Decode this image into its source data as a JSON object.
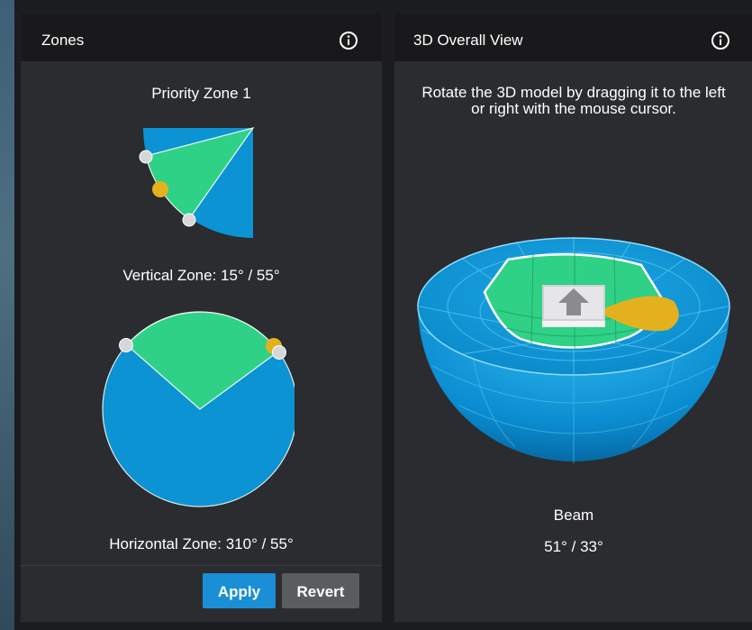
{
  "zones_panel": {
    "title": "Zones",
    "zone_name": "Priority Zone 1",
    "vertical_zone": "Vertical Zone: 15° / 55°",
    "horizontal_zone": "Horizontal Zone: 310° / 55°",
    "apply_label": "Apply",
    "revert_label": "Revert"
  },
  "view_panel": {
    "title": "3D Overall View",
    "instructions": "Rotate the 3D model by dragging it to the left or right with the mouse cursor.",
    "beam_label": "Beam",
    "beam_value": "51° / 33°"
  },
  "icons": {
    "info": "info-icon",
    "handle": "drag-handle",
    "arrow": "up-arrow-icon"
  },
  "colors": {
    "zone_fill": "#2fd186",
    "area_fill": "#0c93d3",
    "handle_active": "#e3b11e",
    "handle_inactive": "#d6d7d9",
    "accent_button": "#1a8fd6",
    "secondary_button": "#5a5c60",
    "panel_bg": "#2b2c2f",
    "header_bg": "#19191b"
  }
}
